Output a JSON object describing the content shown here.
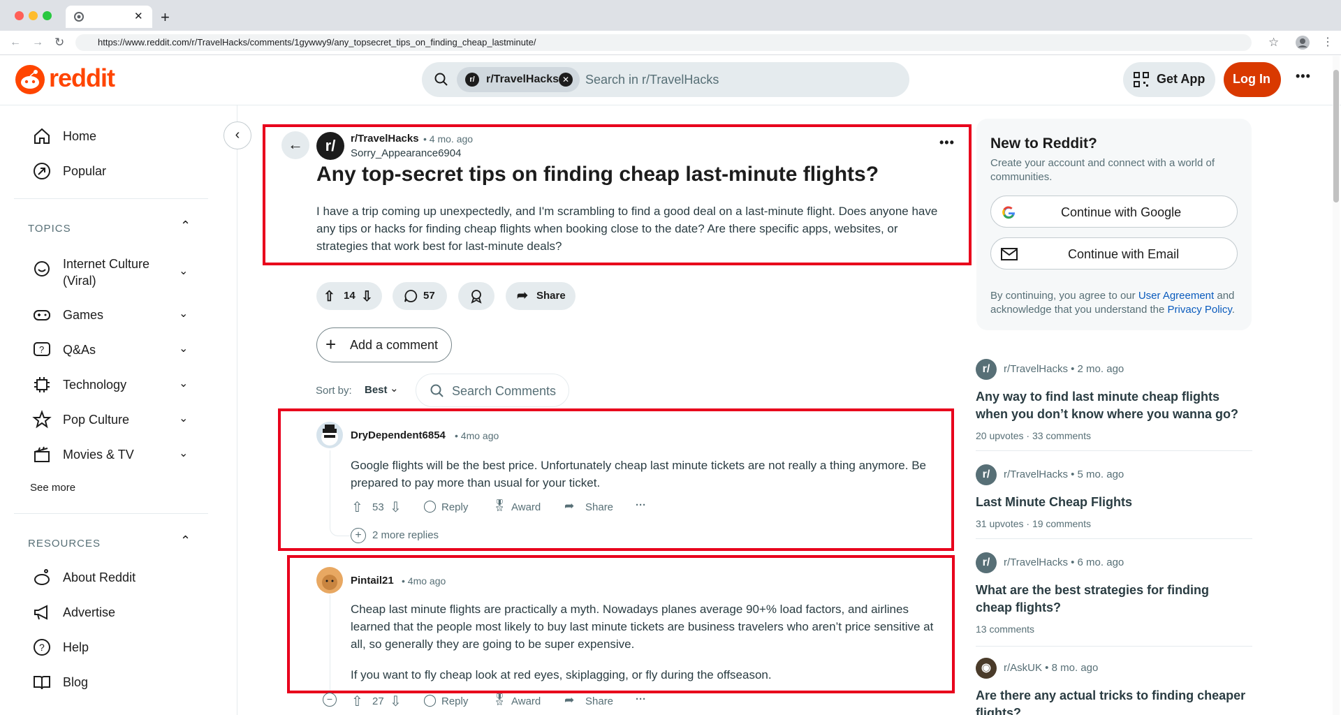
{
  "browser": {
    "url": "https://www.reddit.com/r/TravelHacks/comments/1gywwy9/any_topsecret_tips_on_finding_cheap_lastminute/",
    "new_tab": "+",
    "tab_close": "✕"
  },
  "header": {
    "logo": "reddit",
    "search_chip": "r/TravelHacks",
    "search_placeholder": "Search in r/TravelHacks",
    "get_app": "Get App",
    "login": "Log In",
    "more": "•••"
  },
  "sidebar": {
    "home": "Home",
    "popular": "Popular",
    "topics_title": "TOPICS",
    "topics": [
      "Internet Culture (Viral)",
      "Games",
      "Q&As",
      "Technology",
      "Pop Culture",
      "Movies & TV"
    ],
    "see_more": "See more",
    "resources_title": "RESOURCES",
    "resources": [
      "About Reddit",
      "Advertise",
      "Help",
      "Blog"
    ]
  },
  "post": {
    "subreddit": "r/TravelHacks",
    "time": "• 4 mo. ago",
    "author": "Sorry_Appearance6904",
    "title": "Any top-secret tips on finding cheap last-minute flights?",
    "body": "I have a trip coming up unexpectedly, and I'm scrambling to find a good deal on a last-minute flight. Does anyone have any tips or hacks for finding cheap flights when booking close to the date? Are there specific apps, websites, or strategies that work best for last-minute deals?",
    "upvotes": "14",
    "comments": "57",
    "share": "Share",
    "add_comment": "Add a comment",
    "sort_label": "Sort by:",
    "sort_value": "Best",
    "search_comments": "Search Comments"
  },
  "comments": [
    {
      "author": "DryDependent6854",
      "time": "• 4mo ago",
      "body": "Google flights will be the best price. Unfortunately cheap last minute tickets are not really a thing anymore. Be prepared to pay more than usual for your ticket.",
      "votes": "53",
      "reply": "Reply",
      "award": "Award",
      "share": "Share",
      "more_replies": "2 more replies"
    },
    {
      "author": "Pintail21",
      "time": "• 4mo ago",
      "body": "Cheap last minute flights are practically a myth. Nowadays planes average 90+% load factors, and airlines learned that the people most likely to buy last minute tickets are business travelers who aren’t price sensitive at all, so generally they are going to be super expensive.",
      "body2": "If you want to fly cheap look at red eyes, skiplagging, or fly during the offseason.",
      "votes": "27",
      "reply": "Reply",
      "award": "Award",
      "share": "Share"
    }
  ],
  "signup": {
    "title": "New to Reddit?",
    "subtitle": "Create your account and connect with a world of communities.",
    "google": "Continue with Google",
    "email": "Continue with Email",
    "legal_1": "By continuing, you agree to our",
    "user_agreement": "User Agreement",
    "legal_2": "and acknowledge that you understand the",
    "privacy": "Privacy Policy",
    "period": "."
  },
  "related": [
    {
      "sub": "r/TravelHacks • 2 mo. ago",
      "title": "Any way to find last minute cheap flights when you don’t know where you wanna go?",
      "stats": "20 upvotes  ·  33 comments"
    },
    {
      "sub": "r/TravelHacks • 5 mo. ago",
      "title": "Last Minute Cheap Flights",
      "stats": "31 upvotes  ·  19 comments"
    },
    {
      "sub": "r/TravelHacks • 6 mo. ago",
      "title": "What are the best strategies for finding cheap flights?",
      "stats": "13 comments"
    },
    {
      "sub": "r/AskUK • 8 mo. ago",
      "title": "Are there any actual tricks to finding cheaper flights?",
      "stats": ""
    }
  ],
  "colors": {
    "accent": "#ff4500",
    "highlight": "#e8001c",
    "link": "#0a5bbd"
  }
}
